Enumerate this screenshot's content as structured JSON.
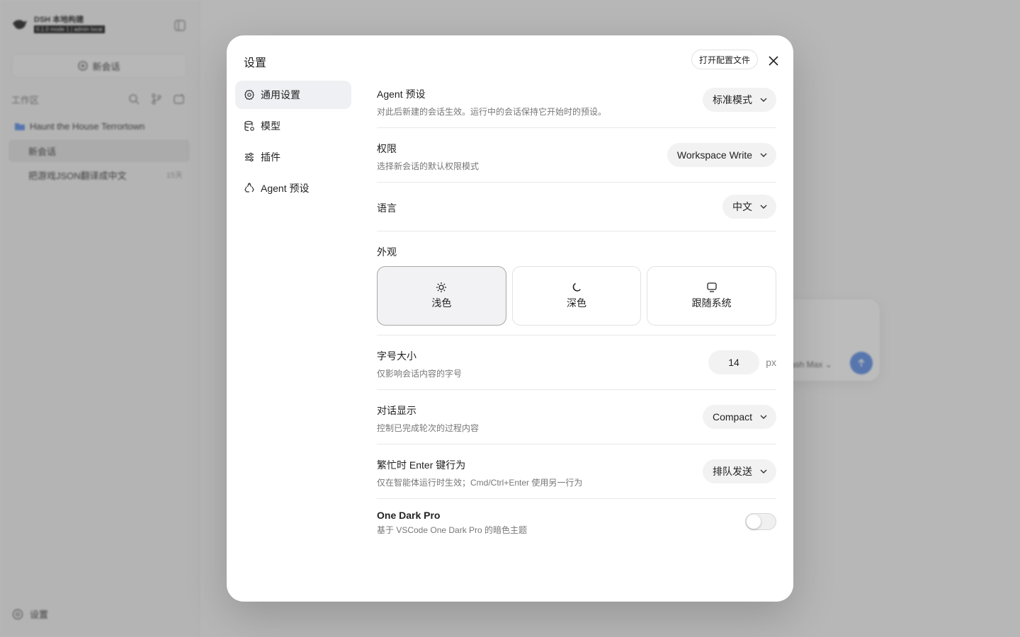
{
  "sidebar": {
    "brand_name": "DSH 本地构建",
    "brand_sub": "0.1.0 mode 1 | admin local",
    "new_chat_label": "新会话",
    "workspace_label": "工作区",
    "project_name": "Haunt the House Terrortown",
    "chats": [
      {
        "title": "新会话",
        "time": ""
      },
      {
        "title": "把游戏JSON翻译成中文",
        "time": "15天"
      }
    ],
    "settings_label": "设置"
  },
  "composer": {
    "model_label": "ash Max"
  },
  "modal": {
    "title": "设置",
    "open_config_label": "打开配置文件",
    "nav": [
      {
        "label": "通用设置",
        "icon": "gear-icon"
      },
      {
        "label": "模型",
        "icon": "database-icon"
      },
      {
        "label": "插件",
        "icon": "sliders-icon"
      },
      {
        "label": "Agent 预设",
        "icon": "recycle-icon"
      }
    ],
    "settings": {
      "agent_preset": {
        "title": "Agent 预设",
        "desc": "对此后新建的会话生效。运行中的会话保持它开始时的预设。",
        "value": "标准模式"
      },
      "permission": {
        "title": "权限",
        "desc": "选择新会话的默认权限模式",
        "value": "Workspace Write"
      },
      "language": {
        "title": "语言",
        "value": "中文"
      },
      "appearance": {
        "title": "外观",
        "options": [
          {
            "label": "浅色",
            "icon": "sun-icon",
            "selected": true
          },
          {
            "label": "深色",
            "icon": "moon-icon",
            "selected": false
          },
          {
            "label": "跟随系统",
            "icon": "monitor-icon",
            "selected": false
          }
        ]
      },
      "font_size": {
        "title": "字号大小",
        "desc": "仅影响会话内容的字号",
        "value": "14",
        "unit": "px"
      },
      "chat_display": {
        "title": "对话显示",
        "desc": "控制已完成轮次的过程内容",
        "value": "Compact"
      },
      "busy_enter": {
        "title": "繁忙时 Enter 键行为",
        "desc": "仅在智能体运行时生效；Cmd/Ctrl+Enter 使用另一行为",
        "value": "排队发送"
      },
      "one_dark_pro": {
        "title": "One Dark Pro",
        "desc": "基于 VSCode One Dark Pro 的暗色主题",
        "enabled": false
      }
    }
  }
}
